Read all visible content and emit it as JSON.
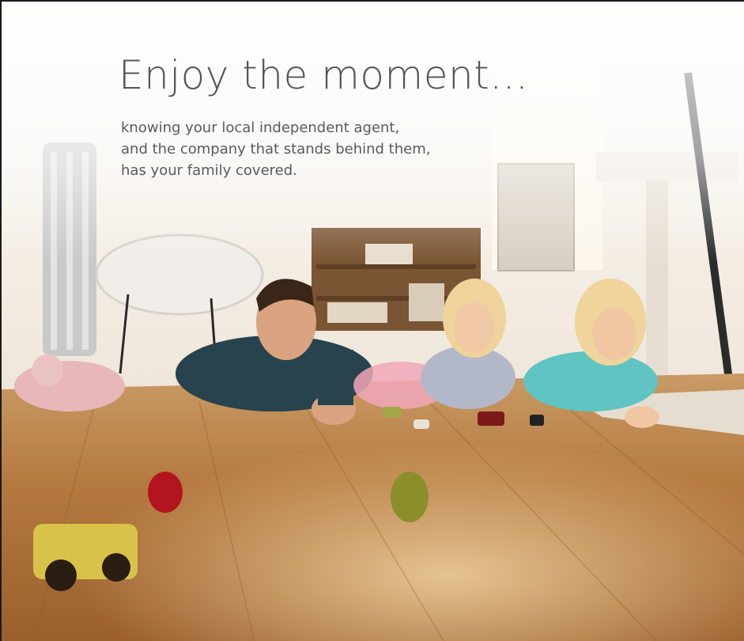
{
  "headline": "Enjoy the moment...",
  "body_lines": [
    "knowing your local independent agent,",
    "and the company that stands behind them,",
    "has your family covered."
  ],
  "photo": {
    "subject": "family-lying-on-wood-floor-with-toy-cars"
  },
  "colors": {
    "headline_text": "#555555",
    "body_text": "#5a5a5a",
    "floor": "#b07238",
    "room": "#f4eee6",
    "frame_border": "#1a1a1a"
  }
}
